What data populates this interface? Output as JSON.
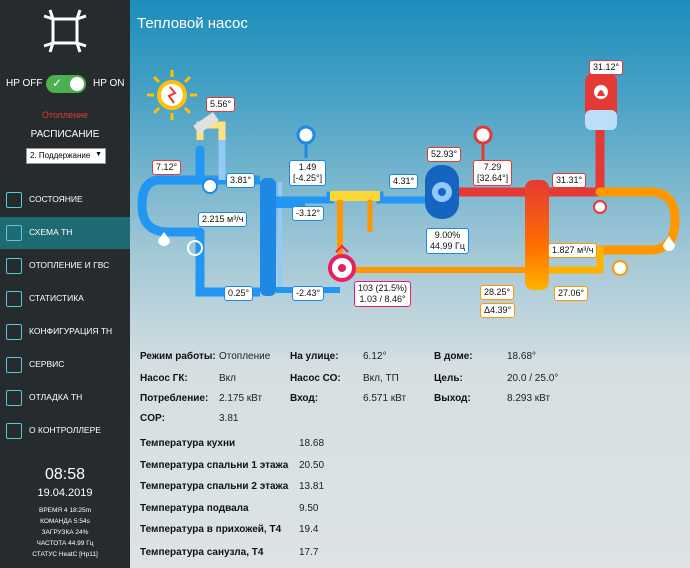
{
  "sidebar": {
    "hp_off": "HP OFF",
    "hp_on": "HP ON",
    "heating": "Отопление",
    "schedule_label": "РАСПИСАНИЕ",
    "schedule_value": "2. Поддержание",
    "nav": [
      {
        "label": "СОСТОЯНИЕ",
        "icon": "house-icon"
      },
      {
        "label": "СХЕМА ТН",
        "icon": "schema-icon"
      },
      {
        "label": "ОТОПЛЕНИЕ И ГВС",
        "icon": "radiator-icon"
      },
      {
        "label": "СТАТИСТИКА",
        "icon": "chart-icon"
      },
      {
        "label": "КОНФИГУРАЦИЯ ТН",
        "icon": "config-icon"
      },
      {
        "label": "СЕРВИС",
        "icon": "tools-icon"
      },
      {
        "label": "ОТЛАДКА ТН",
        "icon": "debug-icon"
      },
      {
        "label": "О КОНТРОЛЛЕРЕ",
        "icon": "cloud-icon"
      }
    ],
    "clock": "08:58",
    "date": "19.04.2019",
    "status": [
      "ВРЕМЯ 4 18:25m",
      "КОМАНДА 5:54s",
      "ЗАГРУЗКА 24%",
      "ЧАСТОТА 44.99 Гц",
      "СТАТУС HeatC [Hp11]"
    ]
  },
  "main": {
    "title": "Тепловой насос",
    "schema": {
      "sun_temp": "5.56°",
      "outdoor_temp": "7.12°",
      "pre_hx_temp": "3.81°",
      "flow": "2.215 м³/ч",
      "brine_return": "0.25°",
      "pressure_lp": "1.49",
      "pressure_lp_sub": "[-4.25°]",
      "evap_out": "-3.12°",
      "evap_in": "-2.43°",
      "suction": "4.31°",
      "compressor_temp": "52.93°",
      "compressor_load": "9.00%",
      "compressor_freq": "44.99 Гц",
      "pressure_hp": "7.29",
      "pressure_hp_sub": "[32.64°]",
      "eev": "103 (21.5%)",
      "eev_sub": "1.03 / 8.46°",
      "liquid": "28.25°",
      "delta": "Δ4.39°",
      "boiler_temp": "31.12°",
      "supply": "31.31°",
      "heat_flow": "1.827 м³/ч",
      "heat_return": "27.06°"
    },
    "info": {
      "mode_label": "Режим работы:",
      "mode_value": "Отопление",
      "outside_label": "На улице:",
      "outside_value": "6.12°",
      "home_label": "В доме:",
      "home_value": "18.68°",
      "pump_gk_label": "Насос ГК:",
      "pump_gk_value": "Вкл",
      "pump_co_label": "Насос СО:",
      "pump_co_value": "Вкл, ТП",
      "target_label": "Цель:",
      "target_value": "20.0 / 25.0°",
      "consumption_label": "Потребление:",
      "consumption_value": "2.175 кВт",
      "input_label": "Вход:",
      "input_value": "6.571 кВт",
      "output_label": "Выход:",
      "output_value": "8.293 кВт",
      "cop_label": "COP:",
      "cop_value": "3.81"
    },
    "temps": [
      {
        "label": "Температура кухни",
        "value": "18.68"
      },
      {
        "label": "Температура спальни 1 этажа",
        "value": "20.50"
      },
      {
        "label": "Температура спальни 2 этажа",
        "value": "13.81"
      },
      {
        "label": "Температура подвала",
        "value": "9.50"
      },
      {
        "label": "Температура в прихожей, Т4",
        "value": "19.4"
      },
      {
        "label": "Температура санузла, Т4",
        "value": "17.7"
      }
    ]
  },
  "colors": {
    "sidebar": "#262b2e",
    "active": "#1f6b73",
    "cold": "#1e88e5",
    "hot": "#e53935",
    "warm": "#ff9800"
  }
}
